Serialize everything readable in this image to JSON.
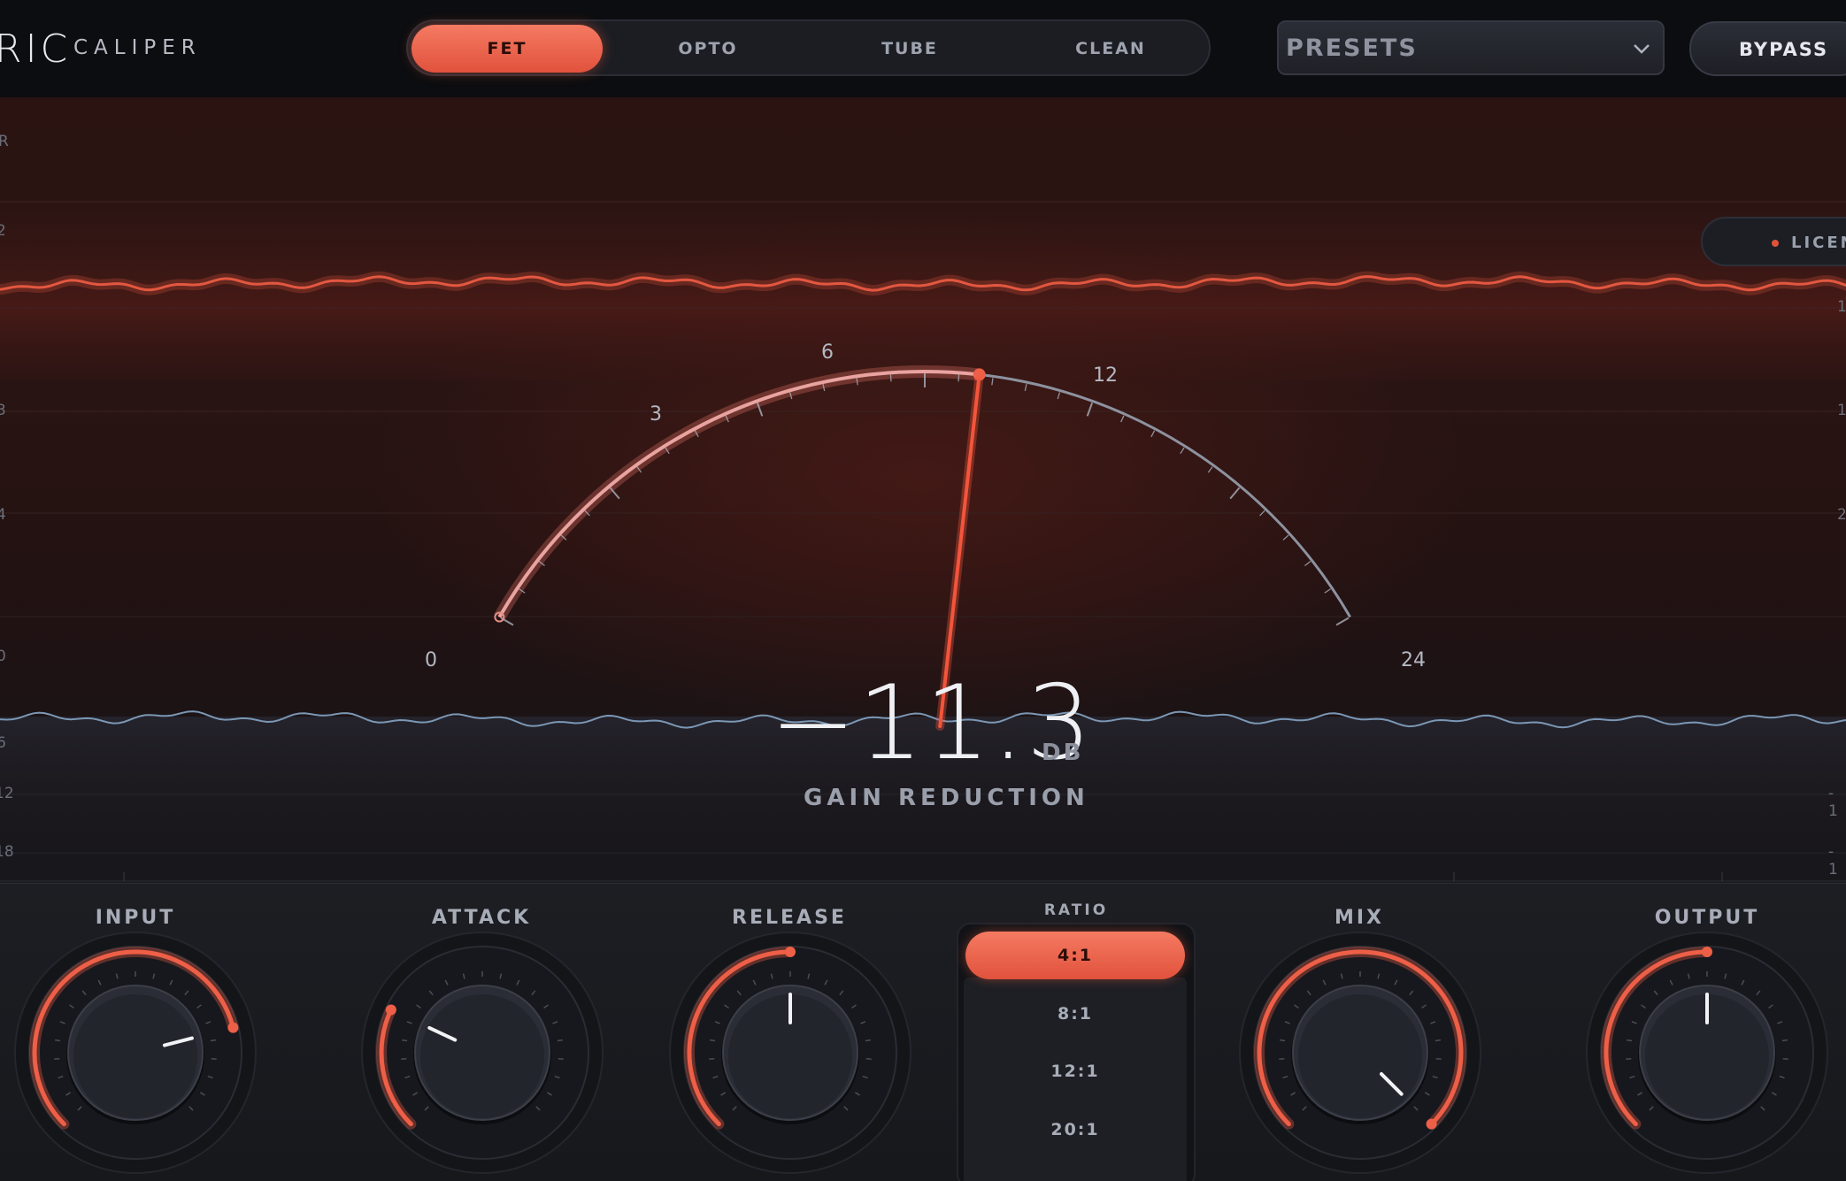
{
  "header": {
    "brand": "RIC",
    "product": "CALIPER",
    "modes": [
      {
        "label": "FET",
        "active": true
      },
      {
        "label": "OPTO",
        "active": false
      },
      {
        "label": "TUBE",
        "active": false
      },
      {
        "label": "CLEAN",
        "active": false
      }
    ],
    "presets_label": "PRESETS",
    "bypass_label": "BYPASS"
  },
  "display": {
    "license_label": "LICENS",
    "left_scale": [
      "R",
      "2",
      "3",
      "4",
      "0",
      "6",
      "12",
      "18"
    ],
    "right_scale": [
      "1",
      "1",
      "2",
      "- 1",
      "- 1"
    ],
    "meter": {
      "ticks": [
        "0",
        "3",
        "6",
        "12",
        "24"
      ],
      "gain_reduction_db": 11.3,
      "value_text": "−11.3",
      "unit": "DB",
      "label": "GAIN REDUCTION"
    }
  },
  "controls": {
    "knobs": [
      {
        "id": "input",
        "label": "INPUT",
        "value_fraction": 0.78
      },
      {
        "id": "attack",
        "label": "ATTACK",
        "value_fraction": 0.26
      },
      {
        "id": "release",
        "label": "RELEASE",
        "value_fraction": 0.5
      },
      {
        "id": "mix",
        "label": "MIX",
        "value_fraction": 1.0
      },
      {
        "id": "output",
        "label": "OUTPUT",
        "value_fraction": 0.5
      }
    ],
    "ratio": {
      "title": "RATIO",
      "options": [
        {
          "label": "4:1",
          "active": true
        },
        {
          "label": "8:1",
          "active": false
        },
        {
          "label": "12:1",
          "active": false
        },
        {
          "label": "20:1",
          "active": false
        }
      ]
    }
  },
  "colors": {
    "accent": "#ee5f47",
    "needle": "#f2553c",
    "dial_track": "#8d929f",
    "trace_input": "#e35740",
    "trace_output": "#7b97b4"
  }
}
